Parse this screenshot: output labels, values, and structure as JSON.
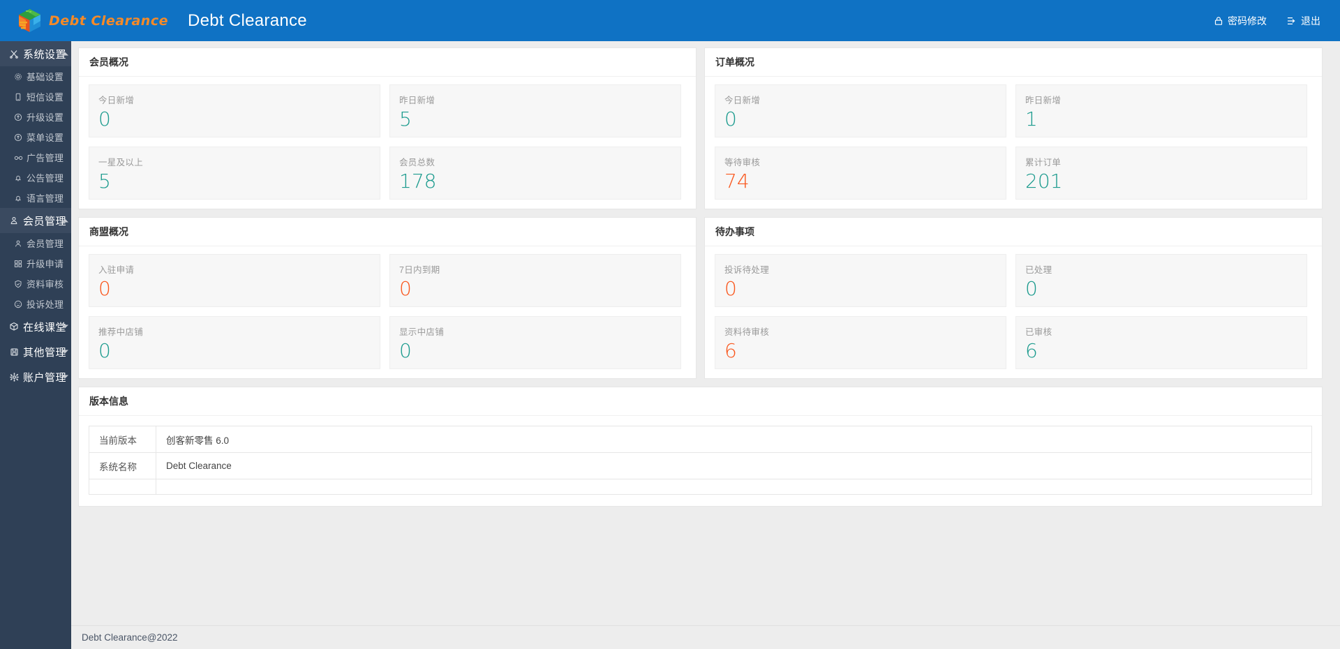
{
  "brand": {
    "logo_icon": "cube-logo-icon",
    "logo_text": "Debt Clearance",
    "app_title": "Debt Clearance"
  },
  "header": {
    "actions": [
      {
        "icon": "lock-icon",
        "label": "密码修改"
      },
      {
        "icon": "logout-icon",
        "label": "退出"
      }
    ]
  },
  "sidebar": {
    "groups": [
      {
        "icon": "scissors-icon",
        "label": "系统设置",
        "expanded": true,
        "caret": "up",
        "items": [
          {
            "icon": "gear-icon",
            "label": "基础设置"
          },
          {
            "icon": "mobile-icon",
            "label": "短信设置"
          },
          {
            "icon": "up-circle-icon",
            "label": "升级设置"
          },
          {
            "icon": "up-circle-icon",
            "label": "菜单设置"
          },
          {
            "icon": "glasses-icon",
            "label": "广告管理"
          },
          {
            "icon": "bell-icon",
            "label": "公告管理"
          },
          {
            "icon": "bell-icon",
            "label": "语言管理"
          }
        ]
      },
      {
        "icon": "user-badge-icon",
        "label": "会员管理",
        "expanded": true,
        "caret": "up",
        "items": [
          {
            "icon": "person-icon",
            "label": "会员管理"
          },
          {
            "icon": "grid-icon",
            "label": "升级申请"
          },
          {
            "icon": "shield-check-icon",
            "label": "资料审核"
          },
          {
            "icon": "sad-face-icon",
            "label": "投诉处理"
          }
        ]
      },
      {
        "icon": "cube-outline-icon",
        "label": "在线课堂",
        "expanded": false,
        "caret": "down",
        "items": []
      },
      {
        "icon": "save-disk-icon",
        "label": "其他管理",
        "expanded": false,
        "caret": "down",
        "items": []
      },
      {
        "icon": "gear-solid-icon",
        "label": "账户管理",
        "expanded": false,
        "caret": "down",
        "items": []
      }
    ]
  },
  "panels": {
    "member_overview": {
      "title": "会员概况",
      "cards": [
        {
          "label": "今日新增",
          "value": "0",
          "color": "#1c9b8e"
        },
        {
          "label": "昨日新增",
          "value": "5",
          "color": "#1c9b8e"
        },
        {
          "label": "一星及以上",
          "value": "5",
          "color": "#1c9b8e"
        },
        {
          "label": "会员总数",
          "value": "178",
          "color": "#1c9b8e"
        }
      ]
    },
    "order_overview": {
      "title": "订单概况",
      "cards": [
        {
          "label": "今日新增",
          "value": "0",
          "color": "#1c9b8e"
        },
        {
          "label": "昨日新增",
          "value": "1",
          "color": "#1c9b8e"
        },
        {
          "label": "等待审核",
          "value": "74",
          "color": "#f9561c"
        },
        {
          "label": "累计订单",
          "value": "201",
          "color": "#1c9b8e"
        }
      ]
    },
    "alliance_overview": {
      "title": "商盟概况",
      "cards": [
        {
          "label": "入驻申请",
          "value": "0",
          "color": "#f9561c"
        },
        {
          "label": "7日内到期",
          "value": "0",
          "color": "#f9561c"
        },
        {
          "label": "推荐中店铺",
          "value": "0",
          "color": "#1c9b8e"
        },
        {
          "label": "显示中店铺",
          "value": "0",
          "color": "#1c9b8e"
        }
      ]
    },
    "todo": {
      "title": "待办事项",
      "cards": [
        {
          "label": "投诉待处理",
          "value": "0",
          "color": "#f9561c"
        },
        {
          "label": "已处理",
          "value": "0",
          "color": "#1c9b8e"
        },
        {
          "label": "资料待审核",
          "value": "6",
          "color": "#f9561c"
        },
        {
          "label": "已审核",
          "value": "6",
          "color": "#1c9b8e"
        }
      ]
    },
    "version_info": {
      "title": "版本信息",
      "rows": [
        {
          "key": "当前版本",
          "value": "创客新零售 6.0"
        },
        {
          "key": "系统名称",
          "value": "Debt Clearance"
        },
        {
          "key": "",
          "value": ""
        }
      ]
    }
  },
  "footer": {
    "text": "Debt Clearance@2022"
  },
  "colors": {
    "header_blue": "#0f72c4",
    "sidebar_dark": "#2f4056",
    "brand_orange": "#f58a28",
    "teal": "#1c9b8e",
    "orange_red": "#f9561c"
  }
}
